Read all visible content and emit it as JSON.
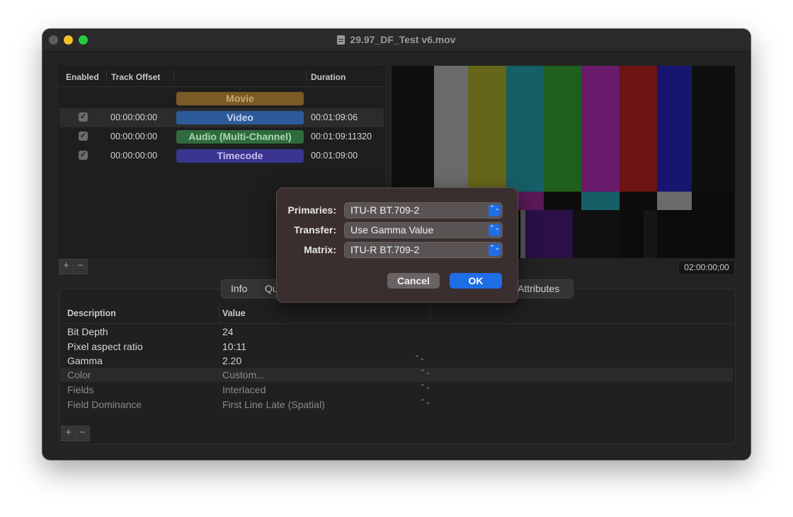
{
  "window": {
    "title": "29.97_DF_Test v6.mov"
  },
  "tracks": {
    "headers": {
      "enabled": "Enabled",
      "offset": "Track Offset",
      "duration": "Duration"
    },
    "rows": [
      {
        "name": "Movie",
        "offset": "",
        "duration": "",
        "enabled": "",
        "color": "#7b5a25",
        "text_color": "#c9a86a"
      },
      {
        "name": "Video",
        "offset": "00:00:00:00",
        "duration": "00:01:09:06",
        "enabled": "✓",
        "color": "#2d5a99",
        "text_color": "#c5d8f3"
      },
      {
        "name": "Audio (Multi-Channel)",
        "offset": "00:00:00:00",
        "duration": "00:01:09:11320",
        "enabled": "✓",
        "color": "#2f6b3f",
        "text_color": "#a8d8b0"
      },
      {
        "name": "Timecode",
        "offset": "00:00:00:00",
        "duration": "00:01:09:00",
        "enabled": "✓",
        "color": "#3b358f",
        "text_color": "#c4c0f0"
      }
    ],
    "add": "+",
    "remove": "−"
  },
  "preview": {
    "timecode": "02:00:00;00"
  },
  "tabs": [
    "Info",
    "Qu",
    "Attributes"
  ],
  "info_table": {
    "headers": {
      "description": "Description",
      "value": "Value"
    },
    "rows": [
      {
        "description": "Bit Depth",
        "value": "24",
        "popup": ""
      },
      {
        "description": "Pixel aspect ratio",
        "value": "10:11",
        "popup": ""
      },
      {
        "description": "Gamma",
        "value": "2.20",
        "popup": "⌃⌄"
      },
      {
        "description": "Color",
        "value": "Custom...",
        "popup": "⌃⌄"
      },
      {
        "description": "Fields",
        "value": "Interlaced",
        "popup": "⌃⌄"
      },
      {
        "description": "Field Dominance",
        "value": "First Line Late (Spatial)",
        "popup": "⌃⌄"
      }
    ],
    "add": "+",
    "remove": "−"
  },
  "dialog": {
    "primaries_label": "Primaries:",
    "primaries_value": "ITU-R BT.709-2",
    "transfer_label": "Transfer:",
    "transfer_value": "Use Gamma Value",
    "matrix_label": "Matrix:",
    "matrix_value": "ITU-R BT.709-2",
    "cancel": "Cancel",
    "ok": "OK",
    "chevrons": "⌃⌄"
  },
  "colors": {
    "accent": "#1f6ee6",
    "window_bg": "#232323",
    "dialog_bg": "#3a2e2e"
  }
}
